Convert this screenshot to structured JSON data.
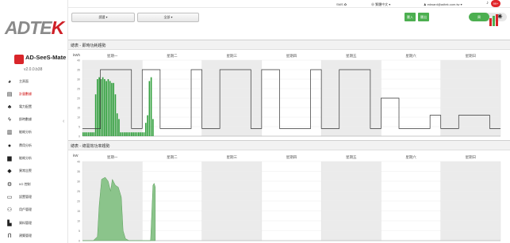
{
  "sidebar": {
    "logo": "ADTEK",
    "app_name": "AD-SeeS-Mate",
    "version": "v2.0.0.b38",
    "items": [
      {
        "icon": "pie-chart-icon",
        "label": "主頁面"
      },
      {
        "icon": "print-icon",
        "label": "計量數據"
      },
      {
        "icon": "sitemap-icon",
        "label": "電力配置"
      },
      {
        "icon": "bolt-icon",
        "label": "即時數據"
      },
      {
        "icon": "bar-chart-icon",
        "label": "能耗分析"
      },
      {
        "icon": "dollar-icon",
        "label": "費用分析"
      },
      {
        "icon": "building-icon",
        "label": "能耗分析"
      },
      {
        "icon": "alert-icon",
        "label": "異常告警"
      },
      {
        "icon": "io-icon",
        "label": "I/O 控制"
      },
      {
        "icon": "window-icon",
        "label": "設置管理"
      },
      {
        "icon": "users-icon",
        "label": "用戶管理"
      },
      {
        "icon": "truck-icon",
        "label": "資料管理"
      },
      {
        "icon": "building-alt-icon",
        "label": "建築管理"
      }
    ]
  },
  "topbar": {
    "sms": "SMS",
    "language": "繁體中文",
    "user": "edward@adtek.com.tw",
    "notifications": "99+"
  },
  "filters": {
    "dropdown1": "請選 ▾",
    "dropdown2": "全部 ▾",
    "btn_import": "匯入",
    "btn_export": "匯出",
    "toggle_on": "周",
    "toggle_off": "月"
  },
  "colors": {
    "accent": "#4caf50",
    "brand": "#cf2027",
    "chart_fill": "#8bc48b",
    "weekend": "#ebebeb"
  },
  "chart_data": [
    {
      "type": "bar",
      "title": "總表 - 即時功耗趨勢",
      "ylabel": "kWh",
      "ylim": [
        0,
        40
      ],
      "yticks": [
        0,
        5,
        10,
        15,
        20,
        25,
        30,
        35,
        40
      ],
      "days": [
        "星期一",
        "星期二",
        "星期三",
        "星期四",
        "星期五",
        "星期六",
        "星期日"
      ],
      "shaded_days": [
        0,
        2,
        4,
        6
      ],
      "series": [
        {
          "name": "",
          "x_day": [
            0.0,
            0.03,
            0.06,
            0.09,
            0.12,
            0.15,
            0.18,
            0.21,
            0.24,
            0.27,
            0.3,
            0.33,
            0.36,
            0.39,
            0.42,
            0.45,
            0.48,
            0.51,
            0.54,
            0.57,
            0.6,
            0.63,
            0.66,
            0.69,
            0.72,
            0.75,
            0.78,
            0.81,
            0.84,
            0.87,
            0.9,
            0.93,
            0.96,
            0.99,
            1.02,
            1.05,
            1.08,
            1.11,
            1.14,
            1.17
          ],
          "values": [
            2,
            2,
            2,
            2,
            2,
            2,
            2,
            22,
            30,
            31,
            30,
            31,
            30,
            29,
            30,
            29,
            28,
            28,
            22,
            12,
            9,
            2,
            2,
            2,
            2,
            2,
            2,
            2,
            2,
            2,
            2,
            2,
            2,
            2,
            2,
            7,
            11,
            29,
            31,
            9
          ]
        }
      ],
      "baseline": {
        "x_day": [
          0,
          0.3,
          0.3,
          0.82,
          0.82,
          1.0,
          1.0,
          1.3,
          1.3,
          1.82,
          1.82,
          2.0,
          2.0,
          2.3,
          2.3,
          2.82,
          2.82,
          3.0,
          3.0,
          3.3,
          3.3,
          3.82,
          3.82,
          4.0,
          4.0,
          4.3,
          4.3,
          4.82,
          4.82,
          5.0,
          5.0,
          5.3,
          5.3,
          5.82,
          5.82,
          6.0,
          6.0,
          6.3,
          6.3,
          6.82,
          6.82,
          7.0
        ],
        "values": [
          4,
          4,
          35,
          35,
          4,
          4,
          35,
          35,
          4,
          4,
          35,
          35,
          4,
          4,
          35,
          35,
          4,
          4,
          35,
          35,
          4,
          4,
          35,
          35,
          4,
          4,
          35,
          35,
          4,
          4,
          20,
          20,
          4,
          4,
          11,
          11,
          4,
          4,
          11,
          11,
          4,
          4
        ]
      }
    },
    {
      "type": "area",
      "title": "總表 - 總需效功率趨勢",
      "ylabel": "kW",
      "ylim": [
        0,
        40
      ],
      "yticks": [
        0,
        5,
        10,
        15,
        20,
        25,
        30,
        35,
        40
      ],
      "days": [
        "星期一",
        "星期二",
        "星期三",
        "星期四",
        "星期五",
        "星期六",
        "星期日"
      ],
      "shaded_days": [
        0,
        2,
        4,
        6
      ],
      "series": [
        {
          "name": "",
          "x_day": [
            0,
            0.05,
            0.1,
            0.18,
            0.25,
            0.28,
            0.32,
            0.38,
            0.43,
            0.47,
            0.5,
            0.55,
            0.6,
            0.65,
            0.68,
            0.72,
            0.78,
            0.82,
            0.85,
            0.88,
            0.93,
            0.97,
            1.0,
            1.05,
            1.1,
            1.14,
            1.18,
            1.2,
            1.22
          ],
          "values": [
            0,
            0,
            0,
            0,
            2,
            18,
            31,
            32,
            30,
            25,
            31,
            28,
            27,
            22,
            5,
            1,
            0,
            0,
            0,
            0,
            0,
            0,
            0,
            0,
            0,
            0,
            28,
            29,
            27
          ]
        }
      ]
    }
  ]
}
